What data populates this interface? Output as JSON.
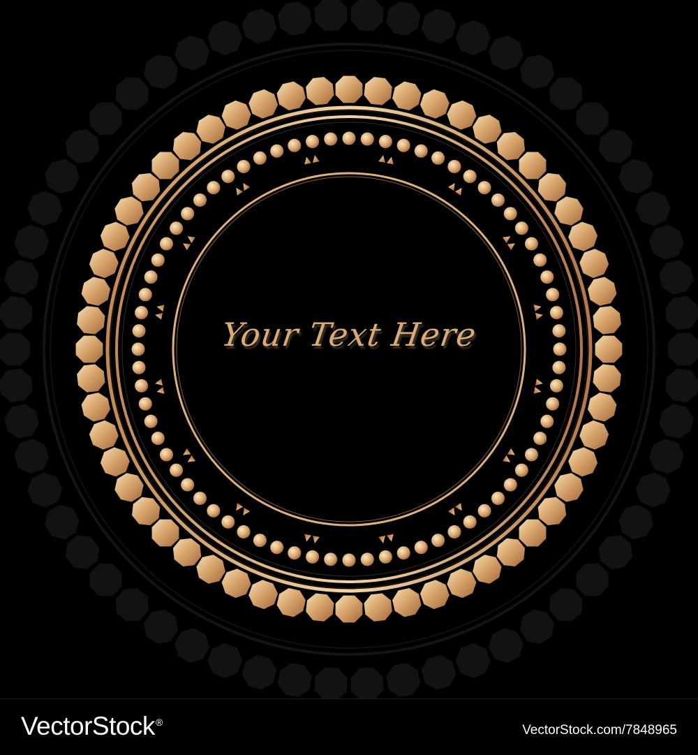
{
  "artwork": {
    "headline": "Your Text Here",
    "colors": {
      "background": "#000000",
      "gold_light": "#f4d9ae",
      "gold_mid": "#d6a46c",
      "gold_dark": "#a8693a",
      "ghost_ring": "#161616"
    }
  },
  "footer": {
    "brand": "VectorStock",
    "brand_mark": "®",
    "image_ref": "VectorStock.com/7848965"
  }
}
